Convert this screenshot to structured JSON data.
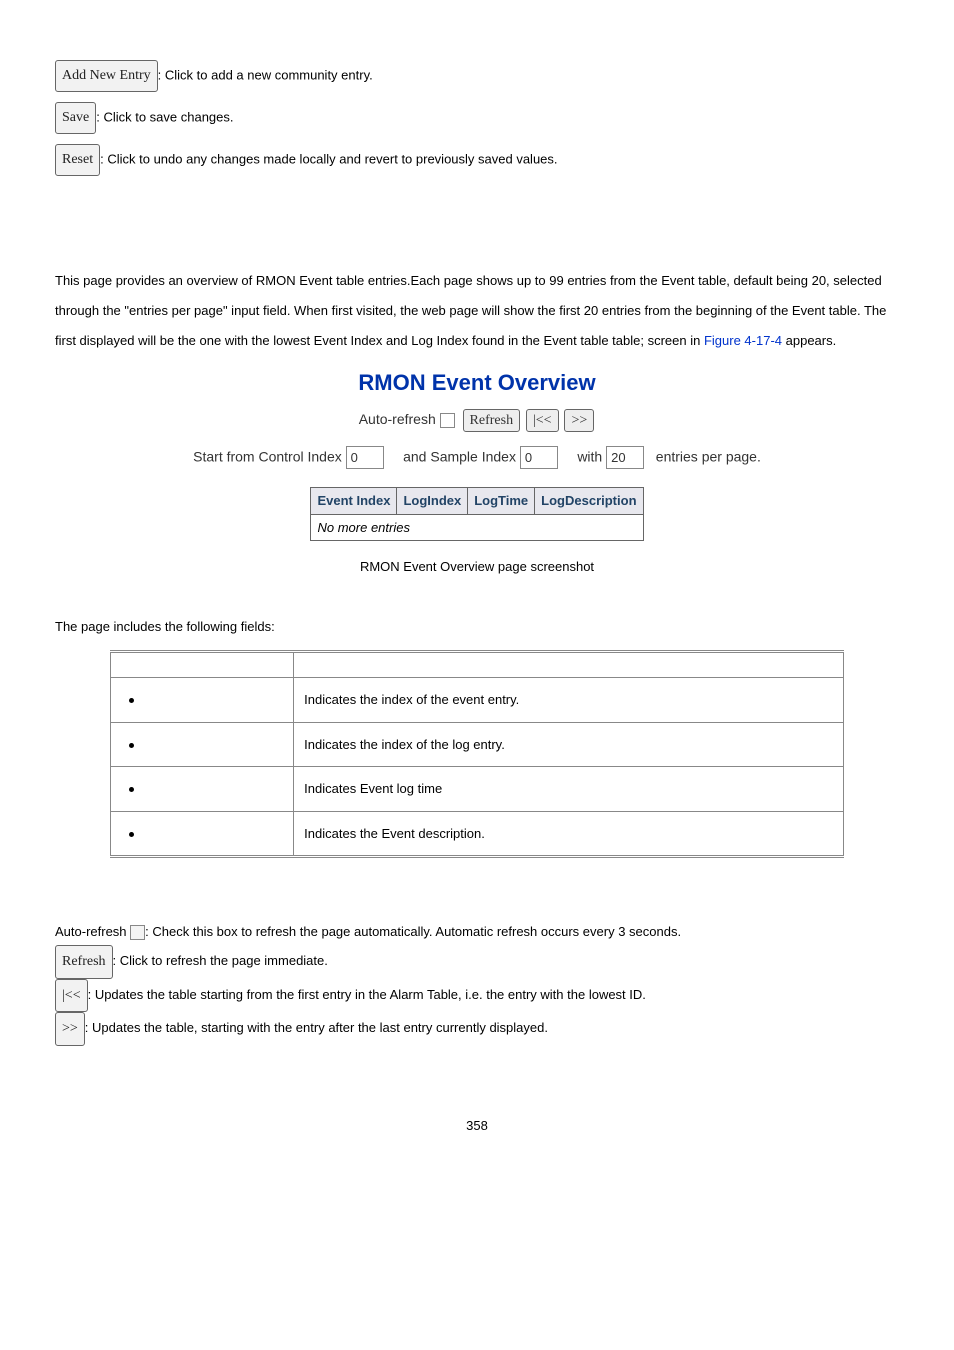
{
  "top": {
    "add_btn": "Add New Entry",
    "add_desc": ": Click to add a new community entry.",
    "save_btn": "Save",
    "save_desc": ": Click to save changes.",
    "reset_btn": "Reset",
    "reset_desc": ": Click to undo any changes made locally and revert to previously saved values."
  },
  "para": {
    "text_a": "This page provides an overview of RMON Event table entries.Each page shows up to 99 entries from the Event table, default being 20, selected through the \"entries per page\" input field. When first visited, the web page will show the first 20 entries from the beginning of the Event table. The first displayed will be the one with the lowest Event Index and Log Index found in the Event table table; screen in ",
    "fig": "Figure 4-17-4",
    "text_b": " appears."
  },
  "ss": {
    "title": "RMON Event Overview",
    "auto_label": "Auto-refresh",
    "refresh_btn": "Refresh",
    "first_btn": "|<<",
    "next_btn": ">>",
    "row2_a": "Start from Control Index",
    "control_val": "0",
    "row2_b": "and Sample Index",
    "sample_val": "0",
    "row2_c": "with",
    "entries_val": "20",
    "row2_d": "entries per page.",
    "th1": "Event Index",
    "th2": "LogIndex",
    "th3": "LogTime",
    "th4": "LogDescription",
    "empty": "No more entries"
  },
  "caption": "RMON Event Overview page screenshot",
  "fields_intro": "The page includes the following fields:",
  "fields": {
    "r1": "Indicates the index of the event entry.",
    "r2": "Indicates the index of the log entry.",
    "r3": "Indicates Event log time",
    "r4": "Indicates the Event description."
  },
  "bottom": {
    "auto_label": "Auto-refresh ",
    "auto_desc": ": Check this box to refresh the page automatically. Automatic refresh occurs every 3 seconds.",
    "refresh_btn": "Refresh",
    "refresh_desc": ": Click to refresh the page immediate.",
    "first_btn": "|<<",
    "first_desc": ": Updates the table starting from the first entry in the Alarm Table, i.e. the entry with the lowest ID.",
    "next_btn": ">>",
    "next_desc": ": Updates the table, starting with the entry after the last entry currently displayed."
  },
  "page_num": "358"
}
